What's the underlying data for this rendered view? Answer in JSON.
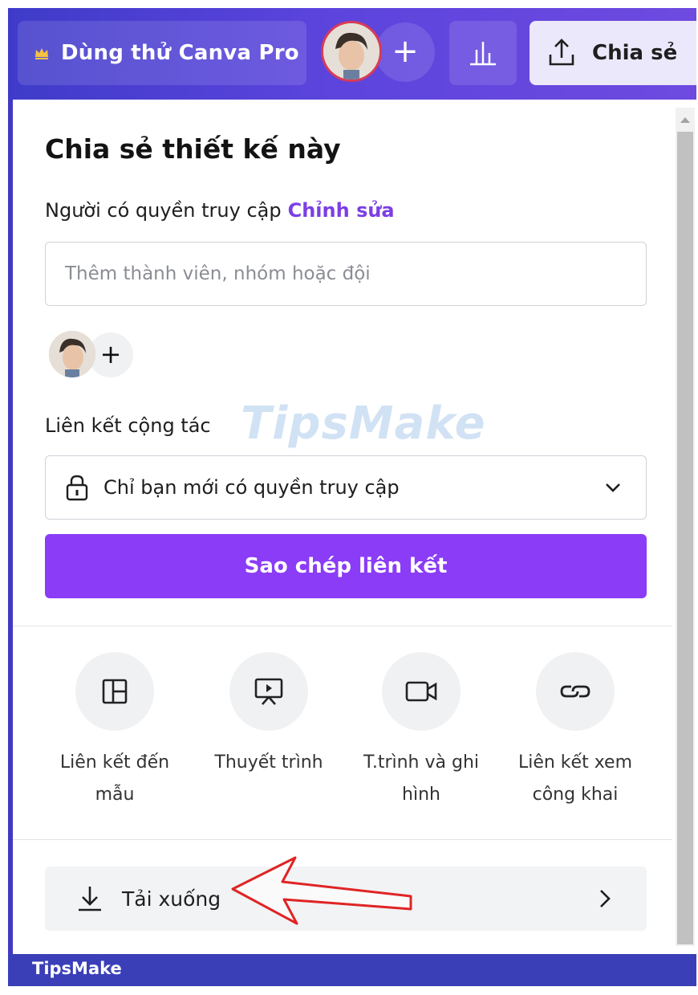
{
  "topbar": {
    "trial_label": "Dùng thử Canva Pro",
    "add_label": "+",
    "share_label": "Chia sẻ"
  },
  "panel": {
    "title": "Chia sẻ thiết kế này",
    "access_label": "Người có quyền truy cập",
    "edit_label": "Chỉnh sửa",
    "member_input": {
      "placeholder": "Thêm thành viên, nhóm hoặc đội"
    },
    "add_member_label": "+",
    "collab_link_label": "Liên kết cộng tác",
    "access_select_value": "Chỉ bạn mới có quyền truy cập",
    "copy_link_label": "Sao chép liên kết",
    "options": [
      {
        "label": "Liên kết đến mẫu",
        "icon": "template-layout-icon"
      },
      {
        "label": "Thuyết trình",
        "icon": "presentation-icon"
      },
      {
        "label": "T.trình và ghi hình",
        "icon": "video-camera-icon"
      },
      {
        "label": "Liên kết xem công khai",
        "icon": "link-icon"
      }
    ],
    "download_label": "Tải xuống"
  },
  "watermark": "TipsMake",
  "footer": {
    "label": "TipsMake"
  },
  "colors": {
    "topbar": "#5b44dc",
    "accent": "#8b3cf7",
    "edit_link": "#7b3fe4",
    "footer": "#3a3fb8",
    "annotation_arrow": "#e02424"
  }
}
